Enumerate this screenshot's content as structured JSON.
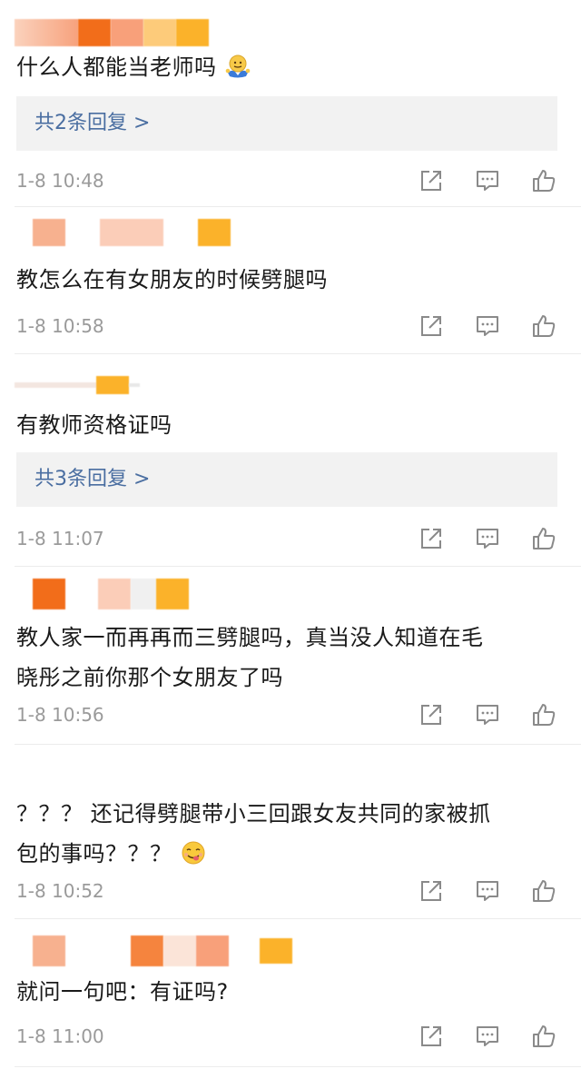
{
  "comments": [
    {
      "text": "什么人都能当老师吗",
      "emoji": "shrug-emoji",
      "reply_label": "共2条回复 >",
      "time": "1-8 10:48"
    },
    {
      "text": "教怎么在有女朋友的时候劈腿吗",
      "time": "1-8 10:58"
    },
    {
      "text": "有教师资格证吗",
      "reply_label": "共3条回复 >",
      "time": "1-8 11:07"
    },
    {
      "text_line1": "教人家一而再再而三劈腿吗，真当没人知道在毛",
      "text_line2": "晓彤之前你那个女朋友了吗",
      "time": "1-8 10:56"
    },
    {
      "text_line1": "？？？ 还记得劈腿带小三回跟女友共同的家被抓",
      "text_line2": "包的事吗？？？",
      "emoji": "yum-emoji",
      "time": "1-8 10:52"
    },
    {
      "text": "就问一句吧：有证吗?",
      "time": "1-8 11:00"
    }
  ],
  "colors": {
    "text": "#1a1a1a",
    "meta": "#9a9a9a",
    "reply_link": "#4a6ea1",
    "reply_bg": "#f2f2f2",
    "icon": "#8a8a8a"
  },
  "icons": {
    "share": "share-icon",
    "comment": "comment-icon",
    "like": "like-icon"
  }
}
